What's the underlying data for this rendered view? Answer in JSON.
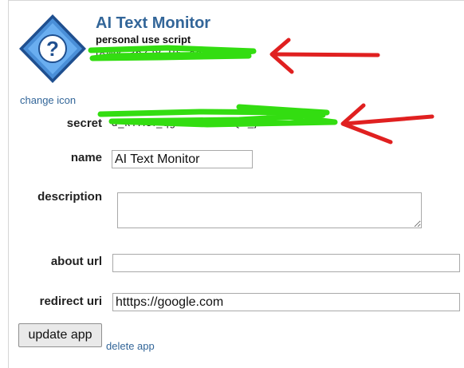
{
  "app": {
    "name": "AI Text Monitor",
    "type_label": "personal use script",
    "client_id": "t8Wk_3nZJ8_B5_oq",
    "change_icon_label": "change icon"
  },
  "form": {
    "secret": {
      "label": "secret",
      "value": "d_kTH5f_qg0Lh8...u7sQ2_jWc"
    },
    "name": {
      "label": "name",
      "value": "AI Text Monitor"
    },
    "description": {
      "label": "description",
      "value": ""
    },
    "about_url": {
      "label": "about url",
      "value": ""
    },
    "redirect_uri": {
      "label": "redirect uri",
      "value": "htttps://google.com"
    }
  },
  "actions": {
    "update_label": "update app",
    "delete_label": "delete app"
  },
  "annotations": {
    "redaction_color": "#33dd11",
    "arrow_color": "#e02020"
  }
}
